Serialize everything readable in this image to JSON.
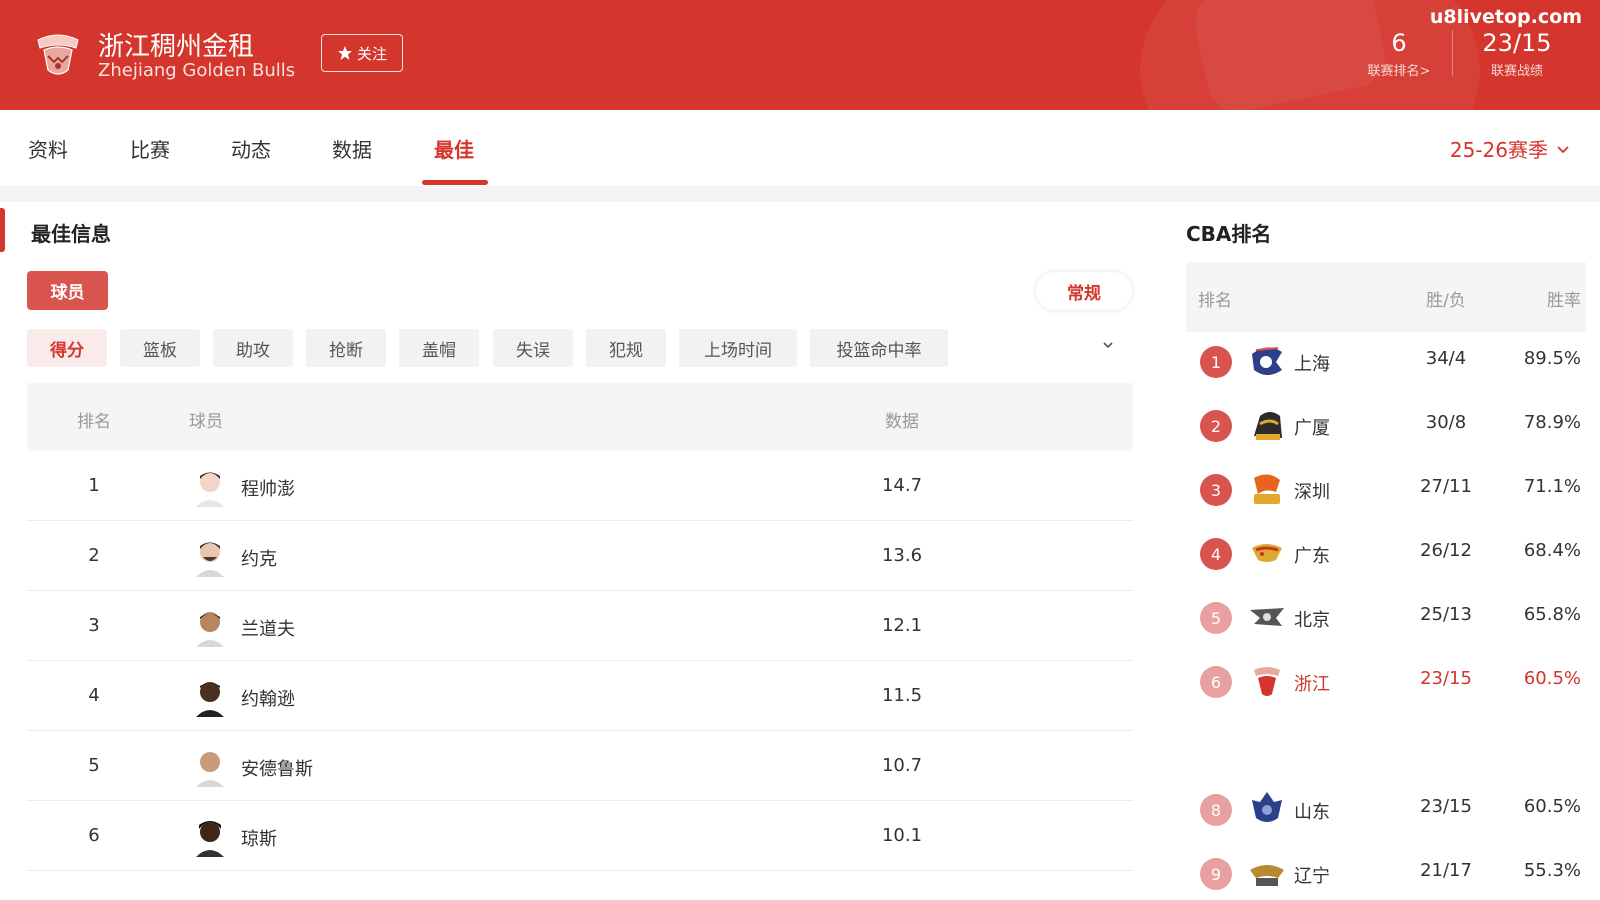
{
  "header": {
    "team_name_cn": "浙江稠州金租",
    "team_name_en": "Zhejiang Golden Bulls",
    "follow_label": "关注",
    "watermark": "u8livetop.com",
    "league_rank_value": "6",
    "league_rank_label": "联赛排名>",
    "league_record_value": "23/15",
    "league_record_label": "联赛战绩",
    "accent_color": "#d4352c"
  },
  "nav": {
    "tabs": [
      {
        "label": "资料"
      },
      {
        "label": "比赛"
      },
      {
        "label": "动态"
      },
      {
        "label": "数据"
      },
      {
        "label": "最佳"
      }
    ],
    "active_tab": "最佳",
    "season": "25-26赛季"
  },
  "best": {
    "title": "最佳信息",
    "type_chip": "球员",
    "phase_chip": "常规",
    "categories": [
      {
        "label": "得分"
      },
      {
        "label": "篮板"
      },
      {
        "label": "助攻"
      },
      {
        "label": "抢断"
      },
      {
        "label": "盖帽"
      },
      {
        "label": "失误"
      },
      {
        "label": "犯规"
      },
      {
        "label": "上场时间"
      },
      {
        "label": "投篮命中率"
      }
    ],
    "active_category": "得分",
    "columns": {
      "rank": "排名",
      "player": "球员",
      "value": "数据"
    },
    "rows": [
      {
        "rank": "1",
        "name": "程帅澎",
        "value": "14.7"
      },
      {
        "rank": "2",
        "name": "约克",
        "value": "13.6"
      },
      {
        "rank": "3",
        "name": "兰道夫",
        "value": "12.1"
      },
      {
        "rank": "4",
        "name": "约翰逊",
        "value": "11.5"
      },
      {
        "rank": "5",
        "name": "安德鲁斯",
        "value": "10.7"
      },
      {
        "rank": "6",
        "name": "琼斯",
        "value": "10.1"
      }
    ]
  },
  "cba": {
    "title": "CBA排名",
    "columns": {
      "rank": "排名",
      "wl": "胜/负",
      "pct": "胜率"
    },
    "rows": [
      {
        "rank": "1",
        "team": "上海",
        "wl": "34/4",
        "pct": "89.5%"
      },
      {
        "rank": "2",
        "team": "广厦",
        "wl": "30/8",
        "pct": "78.9%"
      },
      {
        "rank": "3",
        "team": "深圳",
        "wl": "27/11",
        "pct": "71.1%"
      },
      {
        "rank": "4",
        "team": "广东",
        "wl": "26/12",
        "pct": "68.4%"
      },
      {
        "rank": "5",
        "team": "北京",
        "wl": "25/13",
        "pct": "65.8%"
      },
      {
        "rank": "6",
        "team": "浙江",
        "wl": "23/15",
        "pct": "60.5%"
      },
      {
        "rank": "8",
        "team": "山东",
        "wl": "23/15",
        "pct": "60.5%"
      },
      {
        "rank": "9",
        "team": "辽宁",
        "wl": "21/17",
        "pct": "55.3%"
      }
    ],
    "highlight_team": "浙江",
    "badge_color_top": "#d9534f",
    "badge_color_rest": "#e8a0a0"
  }
}
